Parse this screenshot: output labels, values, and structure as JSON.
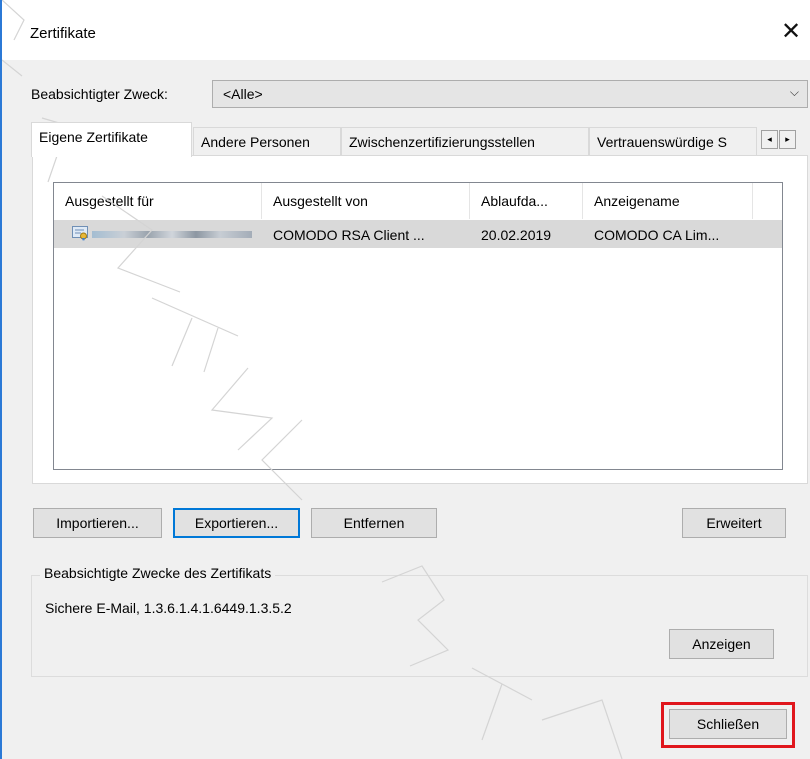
{
  "window": {
    "title": "Zertifikate",
    "close_glyph": "✕",
    "accent": "#2b79d6"
  },
  "purpose": {
    "label": "Beabsichtigter Zweck:",
    "value": "<Alle>",
    "arrow_glyph": "⌵"
  },
  "tabs": [
    {
      "label": "Eigene Zertifikate",
      "active": true
    },
    {
      "label": "Andere Personen",
      "active": false
    },
    {
      "label": "Zwischenzertifizierungsstellen",
      "active": false
    },
    {
      "label": "Vertrauenswürdige S",
      "active": false
    }
  ],
  "tab_scroll": {
    "left_glyph": "◂",
    "right_glyph": "▸"
  },
  "table": {
    "columns": [
      "Ausgestellt für",
      "Ausgestellt von",
      "Ablaufda...",
      "Anzeigename"
    ],
    "rows": [
      {
        "issued_to": "",
        "issued_by": "COMODO RSA Client ...",
        "expires": "20.02.2019",
        "friendly_name": "COMODO CA Lim...",
        "selected": true
      }
    ]
  },
  "buttons": {
    "import": "Importieren...",
    "export": "Exportieren...",
    "remove": "Entfernen",
    "advanced": "Erweitert",
    "view": "Anzeigen",
    "close": "Schließen"
  },
  "purposes_group": {
    "title": "Beabsichtigte Zwecke des Zertifikats",
    "text": "Sichere E-Mail, 1.3.6.1.4.1.6449.1.3.5.2"
  },
  "highlight_color": "#e0161c",
  "icons": [
    "close-icon",
    "dropdown-arrow-icon",
    "certificate-icon",
    "scroll-left-icon",
    "scroll-right-icon"
  ]
}
